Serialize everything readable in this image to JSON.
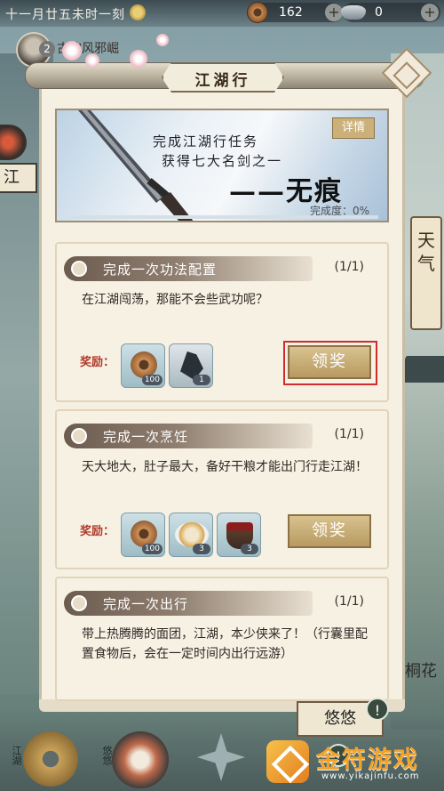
{
  "status_bar": {
    "date": "十一月廿五未时一刻",
    "resources": [
      {
        "icon": "copper-coin-icon",
        "value": "162"
      },
      {
        "icon": "silver-ingot-icon",
        "value": "0"
      }
    ]
  },
  "hud_left": {
    "notice_number": "2",
    "notice_text": "古的风邪崛",
    "tab_label": "江"
  },
  "hud_right": {
    "weather_tab": "天气",
    "flower_label": "桐花"
  },
  "panel": {
    "title": "江湖行",
    "banner": {
      "line1": "完成江湖行任务",
      "line2": "获得七大名剑之一",
      "sword_name": "——无痕",
      "detail_button": "详情",
      "progress_label": "完成度：0%",
      "progress_percent": 0
    },
    "tasks": [
      {
        "title": "完成一次功法配置",
        "count": "(1/1)",
        "desc": "在江湖闯荡，那能不会些武功呢？",
        "reward_label": "奖励：",
        "rewards": [
          {
            "icon": "copper-coin-icon",
            "qty": "100"
          },
          {
            "icon": "martial-scroll-icon",
            "qty": "1"
          }
        ],
        "button": "领奖"
      },
      {
        "title": "完成一次烹饪",
        "count": "(1/1)",
        "desc": "天大地大，肚子最大，备好干粮才能出门行走江湖！",
        "reward_label": "奖励：",
        "rewards": [
          {
            "icon": "copper-coin-icon",
            "qty": "100"
          },
          {
            "icon": "rice-bowl-icon",
            "qty": "3"
          },
          {
            "icon": "water-bucket-icon",
            "qty": "3"
          }
        ],
        "button": "领奖"
      },
      {
        "title": "完成一次出行",
        "count": "(1/1)",
        "desc": "带上热腾腾的面团，江湖，本少侠来了！（行囊里配置食物后，会在一定时间内出行远游）"
      }
    ]
  },
  "bottom_hud": {
    "dock_left_label": "江湖",
    "dock_mid_label": "悠悠",
    "mini_tab": "悠悠",
    "alert_glyph": "!"
  },
  "watermark": {
    "name": "金符游戏",
    "url": "www.yikajinfu.com"
  }
}
